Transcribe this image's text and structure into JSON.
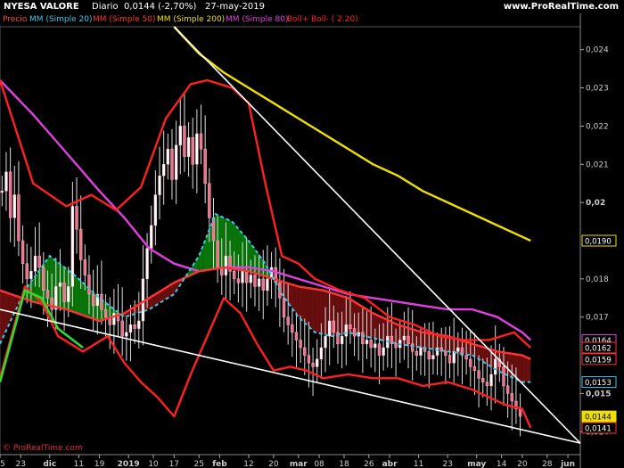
{
  "header": {
    "instrument": "NYESA VALORE",
    "timeframe": "Diario",
    "last_change": "0,0144 (-2,70%)",
    "date": "27-may-2019",
    "site": "www.ProRealTime.com"
  },
  "legend": [
    {
      "label": "Precio",
      "color": "#ff4444",
      "bg": "#000000"
    },
    {
      "label": "MM (Simple 20)",
      "color": "#3cc8e8",
      "bg": "#000000"
    },
    {
      "label": "MM (Simple 50)",
      "color": "#ff3333",
      "bg": "#000000"
    },
    {
      "label": "MM (Simple 200)",
      "color": "#f0e000",
      "bg": "#000000"
    },
    {
      "label": "MM (Simple 80)",
      "color": "#e040e0",
      "bg": "#000000"
    },
    {
      "label": "Boll+",
      "color": "#ff2020",
      "bg": "#000000"
    },
    {
      "label": "Boll- ( 2.20)",
      "color": "#ff2020",
      "bg": "#000000"
    }
  ],
  "watermark": "© ProRealTime.com",
  "chart_data": {
    "type": "candlestick",
    "y_range": [
      0.0134,
      0.0246
    ],
    "y_ticks": [
      {
        "value": 0.024,
        "label": "0,024"
      },
      {
        "value": 0.023,
        "label": "0,023"
      },
      {
        "value": 0.022,
        "label": "0,022"
      },
      {
        "value": 0.021,
        "label": "0,021"
      },
      {
        "value": 0.02,
        "label": "0,02",
        "bold": true
      },
      {
        "value": 0.018,
        "label": "0,018"
      },
      {
        "value": 0.017,
        "label": "0,017"
      },
      {
        "value": 0.015,
        "label": "0,015",
        "bold": true
      },
      {
        "value": 0.014,
        "label": "0,014"
      }
    ],
    "value_boxes": [
      {
        "label": "0,0190",
        "value": 0.019,
        "border": "#f0e000",
        "text": "#ffffff"
      },
      {
        "label": "0,0164",
        "value": 0.0164,
        "border": "#e040e0",
        "text": "#ffffff"
      },
      {
        "label": "0,0162",
        "value": 0.0162,
        "border": "#ff3333",
        "text": "#ffffff"
      },
      {
        "label": "0,0159",
        "value": 0.0159,
        "border": "#ff3333",
        "text": "#ffffff"
      },
      {
        "label": "0,0153",
        "value": 0.0153,
        "border": "#3cc8e8",
        "text": "#ffffff"
      },
      {
        "label": "0,0144",
        "value": 0.0144,
        "border": "#f0e000",
        "text": "#000000",
        "fill": "#f0e000"
      },
      {
        "label": "0,0141",
        "value": 0.0141,
        "border": "#ff3333",
        "text": "#ffffff"
      }
    ],
    "x_ticks": [
      {
        "label": "15",
        "day": 0
      },
      {
        "label": "23",
        "day": 5
      },
      {
        "label": "dic",
        "day": 12,
        "bold": true
      },
      {
        "label": "11",
        "day": 19
      },
      {
        "label": "19",
        "day": 24
      },
      {
        "label": "2019",
        "day": 31,
        "bold": true
      },
      {
        "label": "10",
        "day": 37
      },
      {
        "label": "17",
        "day": 42
      },
      {
        "label": "25",
        "day": 48
      },
      {
        "label": "feb",
        "day": 53,
        "bold": true
      },
      {
        "label": "12",
        "day": 60
      },
      {
        "label": "20",
        "day": 66
      },
      {
        "label": "mar",
        "day": 72,
        "bold": true
      },
      {
        "label": "08",
        "day": 77
      },
      {
        "label": "18",
        "day": 83
      },
      {
        "label": "26",
        "day": 89
      },
      {
        "label": "abr",
        "day": 94,
        "bold": true
      },
      {
        "label": "11",
        "day": 101
      },
      {
        "label": "23",
        "day": 108
      },
      {
        "label": "may",
        "day": 115,
        "bold": true
      },
      {
        "label": "14",
        "day": 121
      },
      {
        "label": "20",
        "day": 126
      },
      {
        "label": "28",
        "day": 132
      },
      {
        "label": "jun",
        "day": 137,
        "bold": true
      }
    ],
    "candles": [
      0.0203,
      0.0208,
      0.0196,
      0.0202,
      0.019,
      0.0184,
      0.018,
      0.0182,
      0.0186,
      0.0183,
      0.0177,
      0.0175,
      0.0172,
      0.0178,
      0.0179,
      0.0174,
      0.0178,
      0.0199,
      0.0193,
      0.0185,
      0.0181,
      0.0176,
      0.0173,
      0.0176,
      0.0172,
      0.017,
      0.0168,
      0.0171,
      0.0169,
      0.0165,
      0.0166,
      0.0168,
      0.0167,
      0.0169,
      0.018,
      0.0188,
      0.0194,
      0.0202,
      0.0207,
      0.021,
      0.0214,
      0.0206,
      0.0215,
      0.022,
      0.0212,
      0.0217,
      0.021,
      0.0218,
      0.0214,
      0.0205,
      0.0196,
      0.019,
      0.0183,
      0.0181,
      0.0186,
      0.0182,
      0.018,
      0.0179,
      0.0182,
      0.0179,
      0.0181,
      0.0178,
      0.018,
      0.0177,
      0.018,
      0.0183,
      0.0179,
      0.0175,
      0.017,
      0.0168,
      0.0166,
      0.0164,
      0.0162,
      0.016,
      0.0158,
      0.0157,
      0.0159,
      0.0162,
      0.0165,
      0.0169,
      0.0166,
      0.0163,
      0.0165,
      0.0168,
      0.0167,
      0.0165,
      0.0166,
      0.0163,
      0.0164,
      0.0162,
      0.0163,
      0.016,
      0.0162,
      0.0165,
      0.0163,
      0.0162,
      0.0164,
      0.0165,
      0.0163,
      0.0161,
      0.016,
      0.0162,
      0.0161,
      0.0159,
      0.016,
      0.0162,
      0.0161,
      0.016,
      0.0158,
      0.0161,
      0.0162,
      0.016,
      0.0159,
      0.0157,
      0.0156,
      0.0154,
      0.0153,
      0.0152,
      0.0155,
      0.0159,
      0.0157,
      0.0152,
      0.015,
      0.0148,
      0.0146,
      0.0144
    ],
    "series": [
      {
        "label": "MM (Simple 200)",
        "color": "#f0e000",
        "points": [
          [
            42,
            0.0246
          ],
          [
            48,
            0.0239
          ],
          [
            54,
            0.0234
          ],
          [
            60,
            0.023
          ],
          [
            66,
            0.0226
          ],
          [
            72,
            0.0222
          ],
          [
            78,
            0.0218
          ],
          [
            84,
            0.0214
          ],
          [
            90,
            0.021
          ],
          [
            96,
            0.0207
          ],
          [
            102,
            0.0203
          ],
          [
            108,
            0.02
          ],
          [
            114,
            0.0197
          ],
          [
            120,
            0.0194
          ],
          [
            126,
            0.0191
          ],
          [
            128,
            0.019
          ]
        ]
      },
      {
        "label": "MM (Simple 80)",
        "color": "#e040e0",
        "points": [
          [
            0,
            0.0232
          ],
          [
            8,
            0.0223
          ],
          [
            16,
            0.0213
          ],
          [
            24,
            0.0203
          ],
          [
            30,
            0.0196
          ],
          [
            36,
            0.0188
          ],
          [
            42,
            0.0184
          ],
          [
            48,
            0.0182
          ],
          [
            54,
            0.0183
          ],
          [
            60,
            0.0183
          ],
          [
            66,
            0.0182
          ],
          [
            72,
            0.018
          ],
          [
            78,
            0.0178
          ],
          [
            84,
            0.0176
          ],
          [
            90,
            0.0175
          ],
          [
            96,
            0.0174
          ],
          [
            102,
            0.0173
          ],
          [
            108,
            0.0172
          ],
          [
            114,
            0.0172
          ],
          [
            120,
            0.017
          ],
          [
            126,
            0.0166
          ],
          [
            128,
            0.0164
          ]
        ]
      },
      {
        "label": "MM (Simple 50)",
        "color": "#ff3333",
        "points": [
          [
            0,
            0.0177
          ],
          [
            8,
            0.0174
          ],
          [
            16,
            0.0172
          ],
          [
            24,
            0.0169
          ],
          [
            30,
            0.0171
          ],
          [
            36,
            0.0175
          ],
          [
            42,
            0.0179
          ],
          [
            48,
            0.0182
          ],
          [
            54,
            0.0183
          ],
          [
            60,
            0.0182
          ],
          [
            66,
            0.018
          ],
          [
            72,
            0.0178
          ],
          [
            78,
            0.0177
          ],
          [
            84,
            0.0175
          ],
          [
            90,
            0.0171
          ],
          [
            96,
            0.0168
          ],
          [
            102,
            0.0166
          ],
          [
            108,
            0.0165
          ],
          [
            114,
            0.0163
          ],
          [
            120,
            0.0161
          ],
          [
            126,
            0.016
          ],
          [
            128,
            0.0159
          ]
        ]
      },
      {
        "label": "MM (Simple 20)",
        "color": "#3cc8e8",
        "points": [
          [
            0,
            0.0163
          ],
          [
            6,
            0.0177
          ],
          [
            12,
            0.0186
          ],
          [
            18,
            0.0181
          ],
          [
            24,
            0.0175
          ],
          [
            30,
            0.017
          ],
          [
            36,
            0.0172
          ],
          [
            42,
            0.0176
          ],
          [
            48,
            0.0186
          ],
          [
            52,
            0.0197
          ],
          [
            56,
            0.0195
          ],
          [
            60,
            0.019
          ],
          [
            64,
            0.0184
          ],
          [
            68,
            0.0176
          ],
          [
            72,
            0.017
          ],
          [
            76,
            0.0166
          ],
          [
            80,
            0.0165
          ],
          [
            84,
            0.0166
          ],
          [
            88,
            0.0165
          ],
          [
            92,
            0.0164
          ],
          [
            96,
            0.0163
          ],
          [
            102,
            0.0162
          ],
          [
            108,
            0.0161
          ],
          [
            114,
            0.016
          ],
          [
            120,
            0.0156
          ],
          [
            126,
            0.0153
          ],
          [
            128,
            0.0153
          ]
        ]
      },
      {
        "label": "Boll+",
        "color": "#ff2020",
        "points": [
          [
            0,
            0.0232
          ],
          [
            8,
            0.0205
          ],
          [
            16,
            0.0199
          ],
          [
            22,
            0.0202
          ],
          [
            28,
            0.0198
          ],
          [
            34,
            0.0204
          ],
          [
            40,
            0.0222
          ],
          [
            46,
            0.0231
          ],
          [
            50,
            0.0232
          ],
          [
            56,
            0.023
          ],
          [
            60,
            0.0226
          ],
          [
            64,
            0.0205
          ],
          [
            68,
            0.0186
          ],
          [
            72,
            0.0184
          ],
          [
            76,
            0.018
          ],
          [
            82,
            0.0177
          ],
          [
            88,
            0.0175
          ],
          [
            94,
            0.017
          ],
          [
            100,
            0.0168
          ],
          [
            106,
            0.0165
          ],
          [
            112,
            0.0164
          ],
          [
            118,
            0.0164
          ],
          [
            124,
            0.0166
          ],
          [
            128,
            0.0162
          ]
        ]
      },
      {
        "label": "Boll-",
        "color": "#ff2020",
        "points": [
          [
            0,
            0.0154
          ],
          [
            6,
            0.0178
          ],
          [
            10,
            0.0174
          ],
          [
            14,
            0.0165
          ],
          [
            20,
            0.0161
          ],
          [
            26,
            0.0165
          ],
          [
            30,
            0.0158
          ],
          [
            34,
            0.0153
          ],
          [
            38,
            0.0149
          ],
          [
            42,
            0.0144
          ],
          [
            46,
            0.0155
          ],
          [
            50,
            0.0165
          ],
          [
            54,
            0.0175
          ],
          [
            58,
            0.0171
          ],
          [
            62,
            0.0163
          ],
          [
            66,
            0.0156
          ],
          [
            70,
            0.0157
          ],
          [
            74,
            0.0156
          ],
          [
            78,
            0.0154
          ],
          [
            84,
            0.0155
          ],
          [
            90,
            0.0154
          ],
          [
            96,
            0.0154
          ],
          [
            102,
            0.0152
          ],
          [
            108,
            0.0153
          ],
          [
            114,
            0.0151
          ],
          [
            118,
            0.0149
          ],
          [
            122,
            0.0147
          ],
          [
            126,
            0.0146
          ],
          [
            128,
            0.0141
          ]
        ]
      }
    ],
    "trendlines": [
      {
        "label": "resistance",
        "color": "#ffffff",
        "points": [
          [
            42,
            0.0246
          ],
          [
            140,
            0.0137
          ]
        ]
      },
      {
        "label": "support",
        "color": "#ffffff",
        "points": [
          [
            0,
            0.0172
          ],
          [
            140,
            0.0137
          ]
        ]
      }
    ]
  }
}
